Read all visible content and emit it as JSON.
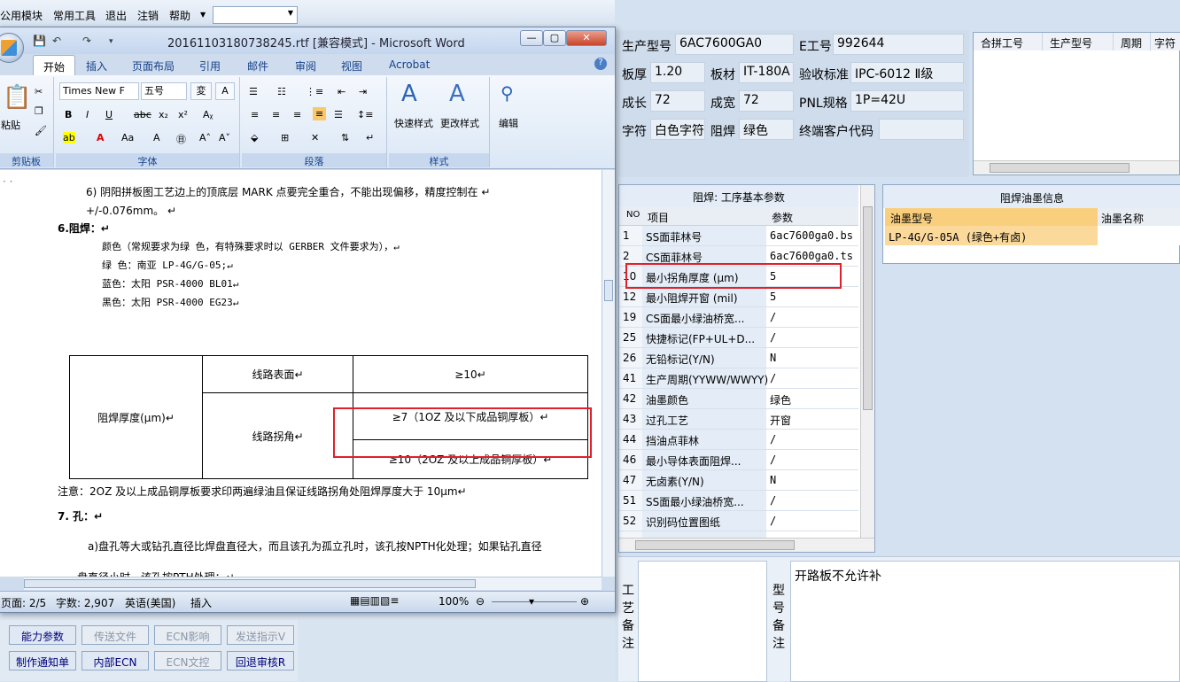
{
  "bg_menu": {
    "items": [
      "公用模块",
      "常用工具",
      "退出",
      "注销",
      "帮助"
    ]
  },
  "prod": {
    "l_model": "生产型号",
    "v_model": "6AC7600GA0",
    "l_eno": "E工号",
    "v_eno": "992644",
    "l_thick": "板厚",
    "v_thick": "1.20",
    "l_mat": "板材",
    "v_mat": "IT-180A",
    "l_std": "验收标准",
    "v_std": "IPC-6012 Ⅱ级",
    "l_len": "成长",
    "v_len": "72",
    "l_wid": "成宽",
    "v_wid": "72",
    "l_pnl": "PNL规格",
    "v_pnl": "1P=42U",
    "l_char": "字符",
    "v_char": "白色字符",
    "l_solder": "阻焊",
    "v_solder": "绿色",
    "l_cust": "终端客户代码",
    "v_cust": ""
  },
  "merge": {
    "headers": [
      "合拼工号",
      "生产型号",
      "周期",
      "字符"
    ]
  },
  "param": {
    "title": "阻焊: 工序基本参数",
    "h_no": "NO",
    "h_item": "项目",
    "h_val": "参数",
    "rows": [
      {
        "no": "1",
        "item": "SS面菲林号",
        "val": "6ac7600ga0.bs"
      },
      {
        "no": "2",
        "item": "CS面菲林号",
        "val": "6ac7600ga0.ts"
      },
      {
        "no": "10",
        "item": "最小拐角厚度 (μm)",
        "val": "5"
      },
      {
        "no": "12",
        "item": "最小阻焊开窗 (mil)",
        "val": "5"
      },
      {
        "no": "19",
        "item": "CS面最小绿油桥宽...",
        "val": "/"
      },
      {
        "no": "25",
        "item": "快捷标记(FP+UL+D...",
        "val": "/"
      },
      {
        "no": "26",
        "item": "无铅标记(Y/N)",
        "val": "N"
      },
      {
        "no": "41",
        "item": "生产周期(YYWW/WWYY)",
        "val": "/"
      },
      {
        "no": "42",
        "item": "油墨颜色",
        "val": "绿色"
      },
      {
        "no": "43",
        "item": "过孔工艺",
        "val": "开窗"
      },
      {
        "no": "44",
        "item": "挡油点菲林",
        "val": "/"
      },
      {
        "no": "46",
        "item": "最小导体表面阻焊...",
        "val": "/"
      },
      {
        "no": "47",
        "item": "无卤素(Y/N)",
        "val": "N"
      },
      {
        "no": "51",
        "item": "SS面最小绿油桥宽...",
        "val": "/"
      },
      {
        "no": "52",
        "item": "识别码位置图纸",
        "val": "/"
      }
    ]
  },
  "ink": {
    "title": "阻焊油墨信息",
    "h_model": "油墨型号",
    "h_name": "油墨名称",
    "r_model": "LP-4G/G-05A (绿色+有卤)"
  },
  "notes": {
    "craft_label": "工艺备注",
    "model_label": "型号备注",
    "model_text": "开路板不允许补"
  },
  "buttons": [
    {
      "label": "能力参数",
      "enabled": true
    },
    {
      "label": "传送文件",
      "enabled": false
    },
    {
      "label": "ECN影响",
      "enabled": false
    },
    {
      "label": "发送指示V",
      "enabled": false
    },
    {
      "label": "制作通知单",
      "enabled": true
    },
    {
      "label": "内部ECN",
      "enabled": true
    },
    {
      "label": "ECN文控",
      "enabled": false
    },
    {
      "label": "回退审核R",
      "enabled": true
    }
  ],
  "word": {
    "title": "20161103180738245.rtf [兼容模式] - Microsoft Word",
    "tabs": [
      "开始",
      "插入",
      "页面布局",
      "引用",
      "邮件",
      "审阅",
      "视图",
      "Acrobat"
    ],
    "font_name": "Times New F",
    "font_size": "五号",
    "groups": [
      "剪贴板",
      "字体",
      "段落",
      "样式"
    ],
    "paste": "粘贴",
    "quick_style": "快速样式",
    "change_style": "更改样式",
    "edit": "编辑",
    "status": {
      "page": "页面: 2/5",
      "words": "字数: 2,907",
      "lang": "英语(美国)",
      "mode": "插入",
      "zoom": "100%"
    }
  },
  "doc": {
    "l6": "6)       阴阳拼板图工艺边上的顶底层 MARK  点要完全重合，不能出现偏移，精度控制在 ↵",
    "l6b": "+/-0.076mm。 ↵",
    "h6": "6.阻焊：↵",
    "c1": "颜色（常规要求为绿 色，有特殊要求时以 GERBER 文件要求为），↵",
    "c2": "绿 色：南亚 LP-4G/G-05;↵",
    "c3": "蓝色：太阳 PSR-4000 BL01↵",
    "c4": "黑色：太阳 PSR-4000 EG23↵",
    "t_label": "阻焊厚度(μm)↵",
    "t_r1a": "线路表面↵",
    "t_r1b": "≥10↵",
    "t_r2a": "线路拐角↵",
    "t_r2b": "≥7（1OZ 及以下成品铜厚板）↵",
    "t_r3b": "≥10（2OZ 及以上成品铜厚板）↵",
    "note": "注意：2OZ 及以上成品铜厚板要求印两遍绿油且保证线路拐角处阻焊厚度大于 10μm↵",
    "h7": "7. 孔：↵",
    "p7a": "a)盘孔等大或钻孔直径比焊盘直径大，而且该孔为孤立孔时，该孔按NPTH化处理；如果钻孔直径",
    "p7b": "盘直径小时，该孔按PTH处理；↵"
  },
  "colors": {
    "highlight_red": "#e0202a",
    "ink_row": "#fbd99a"
  }
}
